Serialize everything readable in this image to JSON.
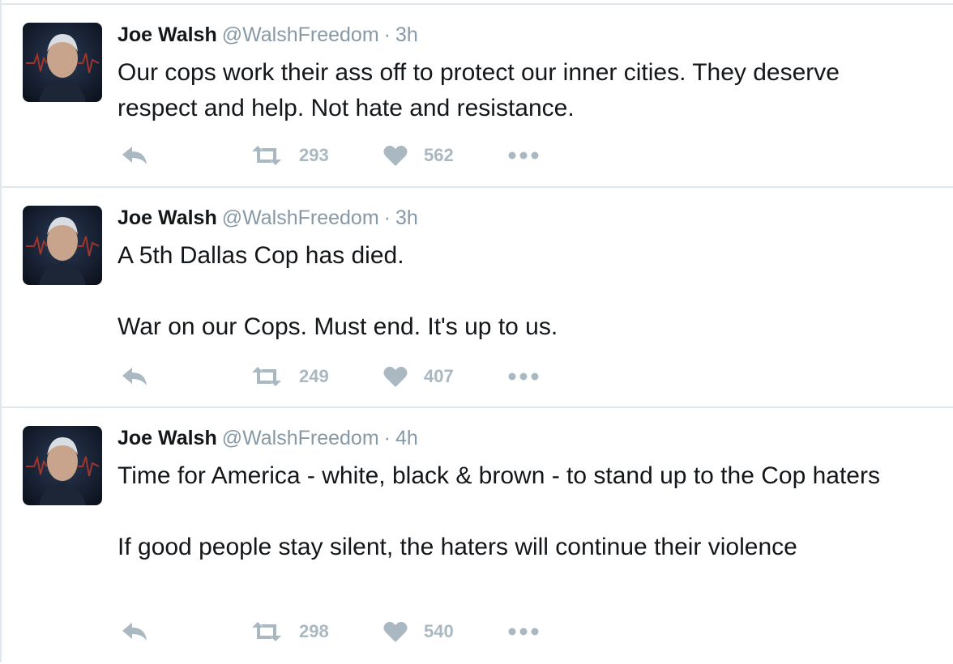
{
  "colors": {
    "name": "#14171a",
    "meta": "#8899a6",
    "action": "#aab8c2",
    "divider": "#e1e8ed"
  },
  "icons": {
    "reply": "reply-icon",
    "retweet": "retweet-icon",
    "like": "heart-icon",
    "more": "more-dots-icon"
  },
  "tweets": [
    {
      "name": "Joe Walsh",
      "handle": "@WalshFreedom",
      "separator": "·",
      "time": "3h",
      "text": "Our cops work their ass off to protect our inner cities. They deserve respect and help. Not hate and resistance.",
      "retweets": "293",
      "likes": "562"
    },
    {
      "name": "Joe Walsh",
      "handle": "@WalshFreedom",
      "separator": "·",
      "time": "3h",
      "text": "A 5th Dallas Cop has died.\n\nWar on our Cops. Must end. It's up to us.",
      "retweets": "249",
      "likes": "407"
    },
    {
      "name": "Joe Walsh",
      "handle": "@WalshFreedom",
      "separator": "·",
      "time": "4h",
      "text": "Time for America - white, black & brown - to stand up to the Cop haters\n\nIf good people stay silent, the haters will continue their violence",
      "retweets": "298",
      "likes": "540"
    }
  ]
}
